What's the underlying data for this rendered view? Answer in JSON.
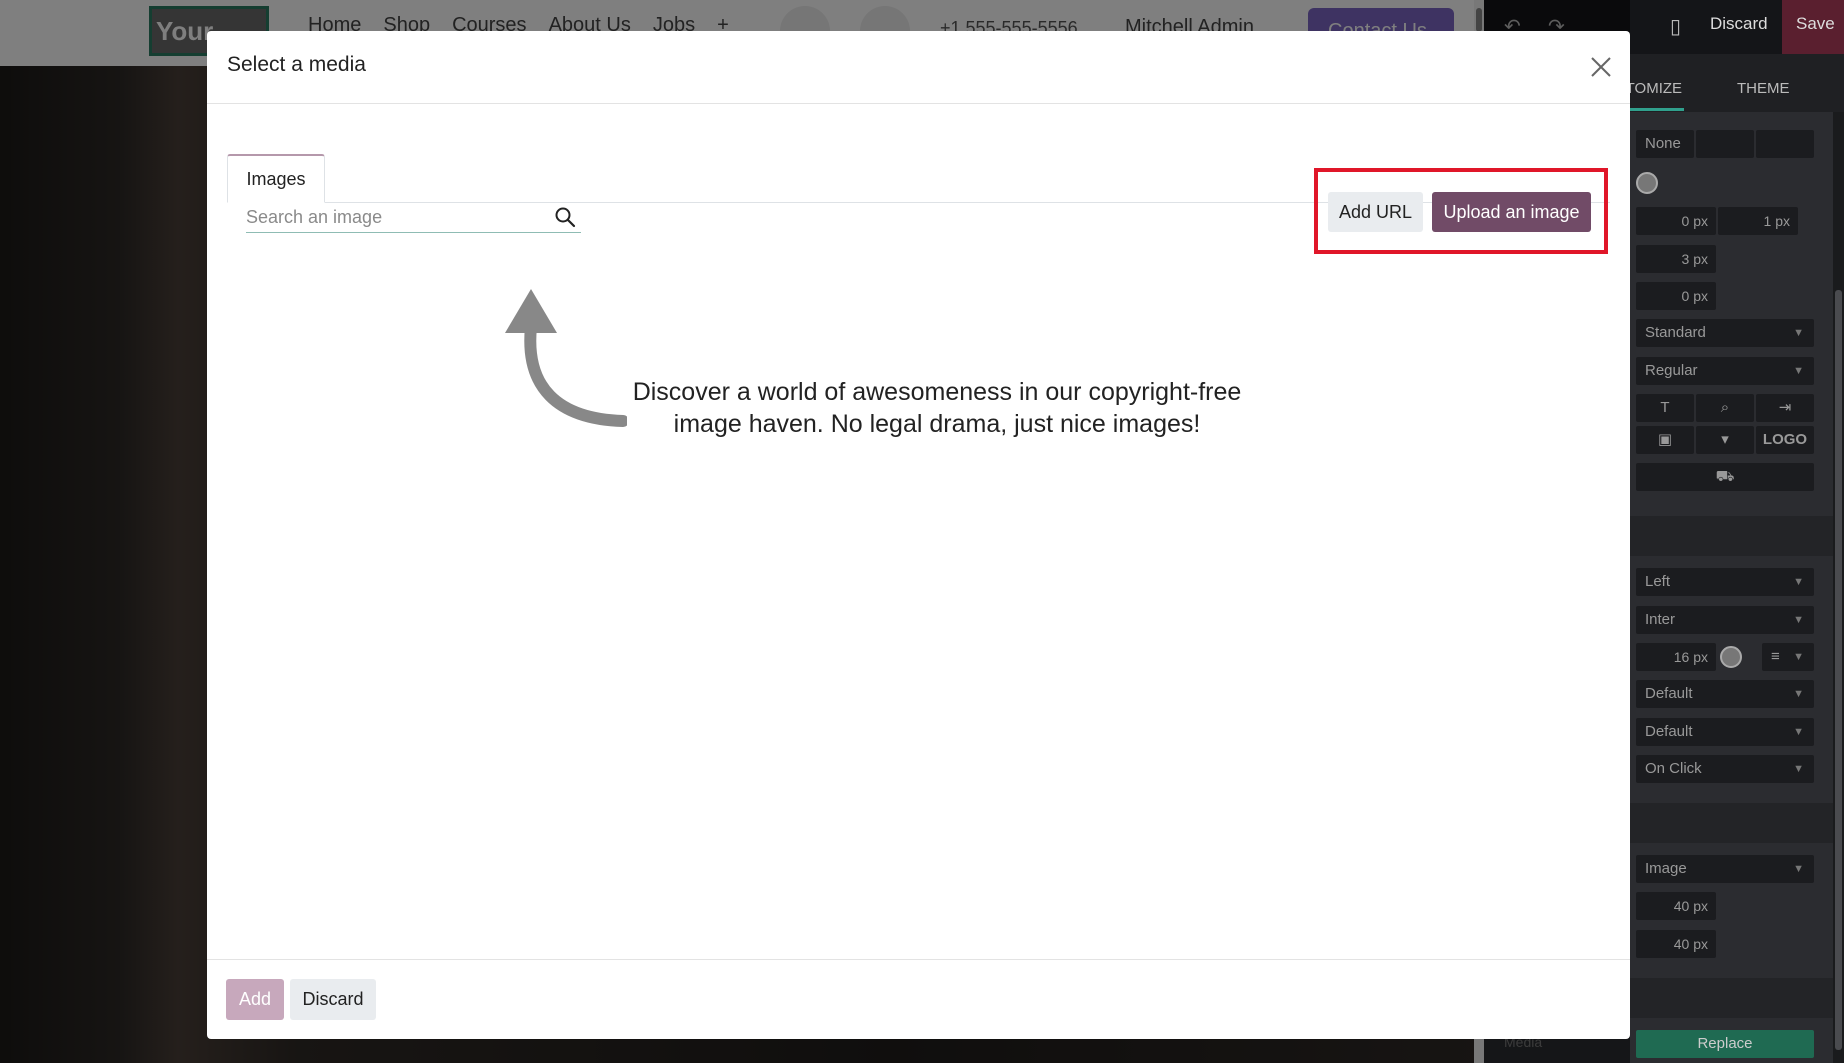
{
  "site": {
    "logo": "Your",
    "nav": [
      "Home",
      "Shop",
      "Courses",
      "About Us",
      "Jobs"
    ],
    "phone": "+1 555-555-5556",
    "user": "Mitchell Admin",
    "contact_label": "Contact Us"
  },
  "editor": {
    "discard_label": "Discard",
    "save_label": "Save",
    "tabs": [
      "CUSTOMIZE",
      "THEME"
    ],
    "rows": {
      "none": "None",
      "border_width_1": "0",
      "border_width_2": "1",
      "radius": "3",
      "shadow": "0",
      "unit": "px",
      "style": "Standard",
      "weight": "Regular",
      "logo_text": "LOGO",
      "align": "Left",
      "font": "Inter",
      "font_size": "16",
      "default_1": "Default",
      "default_2": "Default",
      "on_click": "On Click",
      "image": "Image",
      "width": "40",
      "height": "40"
    },
    "media_label": "Media",
    "replace_label": "Replace"
  },
  "modal": {
    "title": "Select a media",
    "tabs": [
      {
        "label": "Images"
      }
    ],
    "search": {
      "placeholder": "Search an image"
    },
    "add_url_label": "Add URL",
    "upload_label": "Upload an image",
    "hint": "Discover a world of awesomeness in our copyright-free image haven. No legal drama, just nice images!",
    "footer": {
      "add_label": "Add",
      "discard_label": "Discard"
    }
  },
  "colors": {
    "primary": "#714b67",
    "primary_disabled": "#c7a8bc",
    "highlight": "#e01629",
    "editor_accent": "#30a08d"
  }
}
